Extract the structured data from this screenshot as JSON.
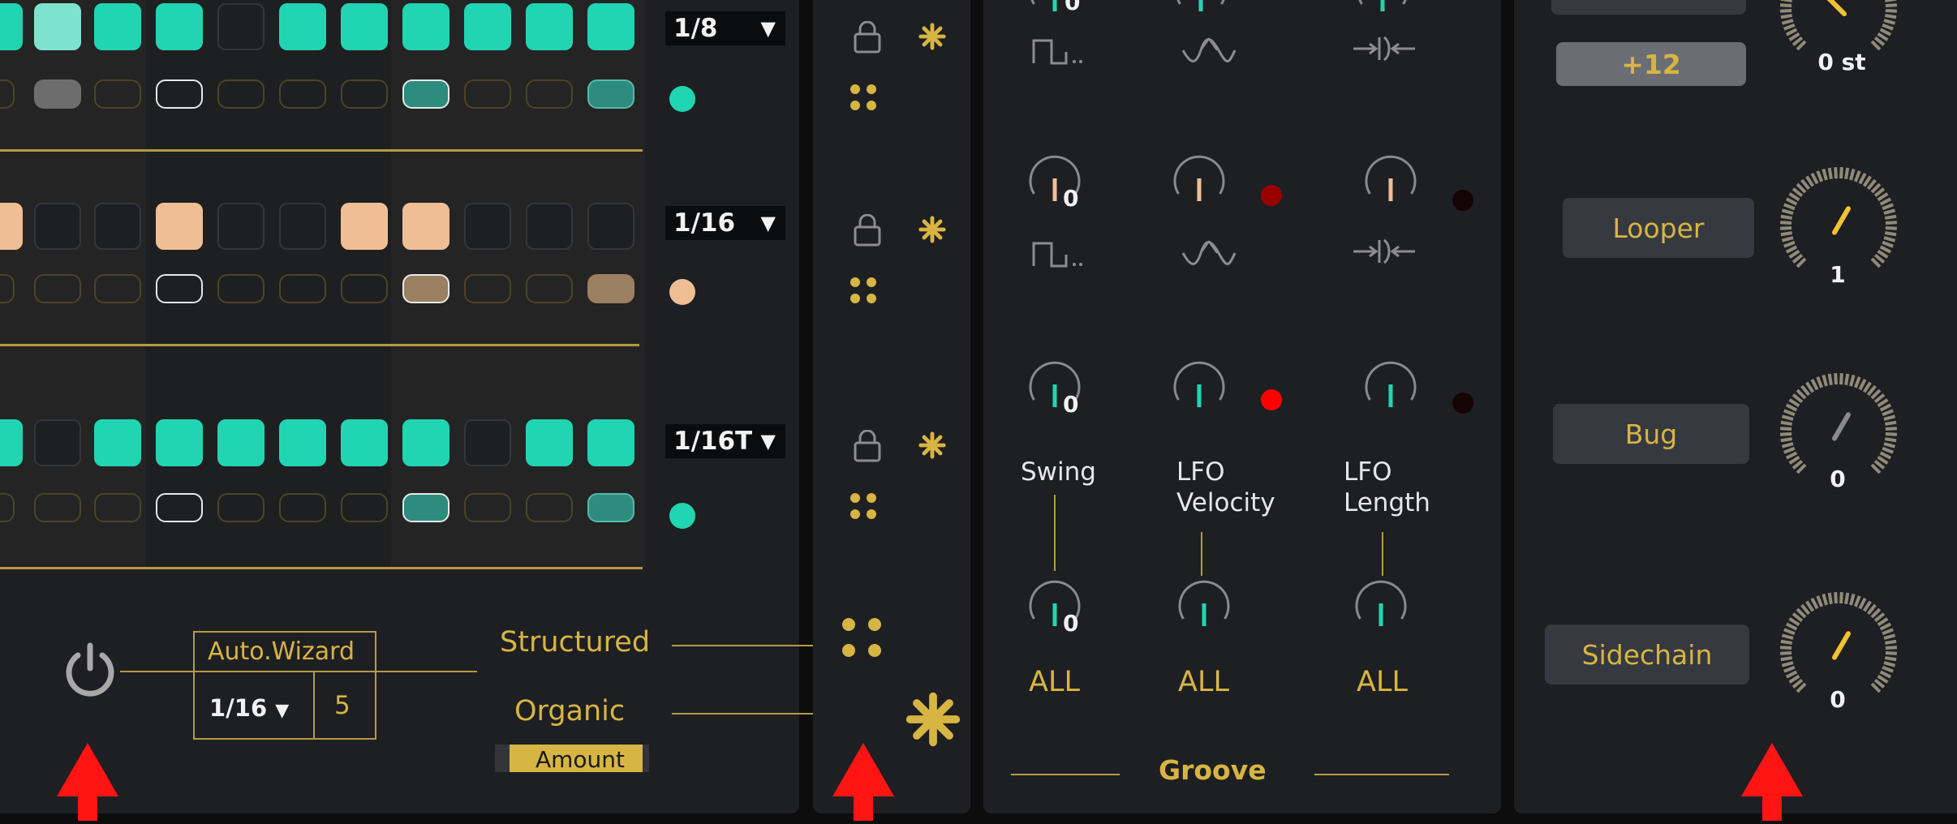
{
  "colors": {
    "teal": "#21d5b2",
    "peach": "#f0be95",
    "gold": "#d7b543",
    "red_arrow": "#ff1414"
  },
  "sequencer": {
    "lanes": [
      {
        "rate": "1/8",
        "dot_color": "#21d5b2"
      },
      {
        "rate": "1/16",
        "dot_color": "#f0be95"
      },
      {
        "rate": "1/16T",
        "dot_color": "#21d5b2"
      }
    ]
  },
  "auto_wizard": {
    "title": "Auto.Wizard",
    "rate": "1/16",
    "count": "5"
  },
  "modes": {
    "structured": "Structured",
    "organic": "Organic",
    "amount": "Amount"
  },
  "groove": {
    "title": "Groove",
    "row2_values": [
      "0"
    ],
    "row3_values": [
      "0"
    ],
    "labels": {
      "swing": "Swing",
      "lfo_velocity_1": "LFO",
      "lfo_velocity_2": "Velocity",
      "lfo_length_1": "LFO",
      "lfo_length_2": "Length"
    },
    "all_labels": [
      "ALL",
      "ALL",
      "ALL"
    ],
    "all_values": [
      "0"
    ],
    "top_values": [
      "0"
    ]
  },
  "fx": {
    "transpose_button": "+12",
    "transpose_value": "0 st",
    "looper": {
      "label": "Looper",
      "value": "1"
    },
    "bug": {
      "label": "Bug",
      "value": "0"
    },
    "sidechain": {
      "label": "Sidechain",
      "value": "0"
    }
  }
}
